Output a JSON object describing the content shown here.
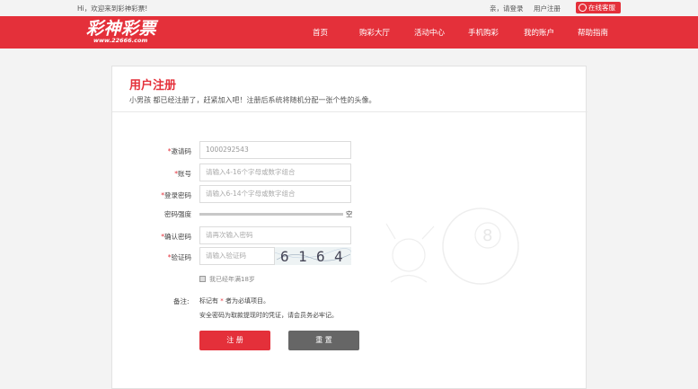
{
  "topbar": {
    "welcome": "Hi，欢迎来到彩神彩票!",
    "login": "亲，请登录",
    "register": "用户注册",
    "service": "在线客服"
  },
  "logo": {
    "main": "彩神彩票",
    "sub": "www.22666.com"
  },
  "nav": [
    "首页",
    "购彩大厅",
    "活动中心",
    "手机购彩",
    "我的账户",
    "帮助指南"
  ],
  "form": {
    "title": "用户注册",
    "subtitle": "小男孩 都已经注册了，赶紧加入吧！注册后系统将随机分配一张个性的头像。",
    "invite": {
      "label": "邀请码",
      "value": "1000292543"
    },
    "account": {
      "label": "账号",
      "placeholder": "请输入4-16个字母或数字组合"
    },
    "password": {
      "label": "登录密码",
      "placeholder": "请输入6-14个字母或数字组合"
    },
    "strength": {
      "label": "密码强度",
      "value": "空"
    },
    "confirm": {
      "label": "确认密码",
      "placeholder": "请再次输入密码"
    },
    "captcha": {
      "label": "验证码",
      "placeholder": "请输入验证码",
      "code": [
        "6",
        "1",
        "6",
        "4"
      ]
    },
    "age_check": "我已经年满18岁",
    "notes": {
      "label": "备注:",
      "line1_pre": "标记有",
      "line1_star": "*",
      "line1_post": "者为必填项目。",
      "line2": "安全密码为取款提现时的凭证，请会员务必牢记。"
    },
    "submit": "注 册",
    "reset": "重 置"
  },
  "colors": {
    "brand": "#e4303a",
    "reset_button": "#666666"
  }
}
